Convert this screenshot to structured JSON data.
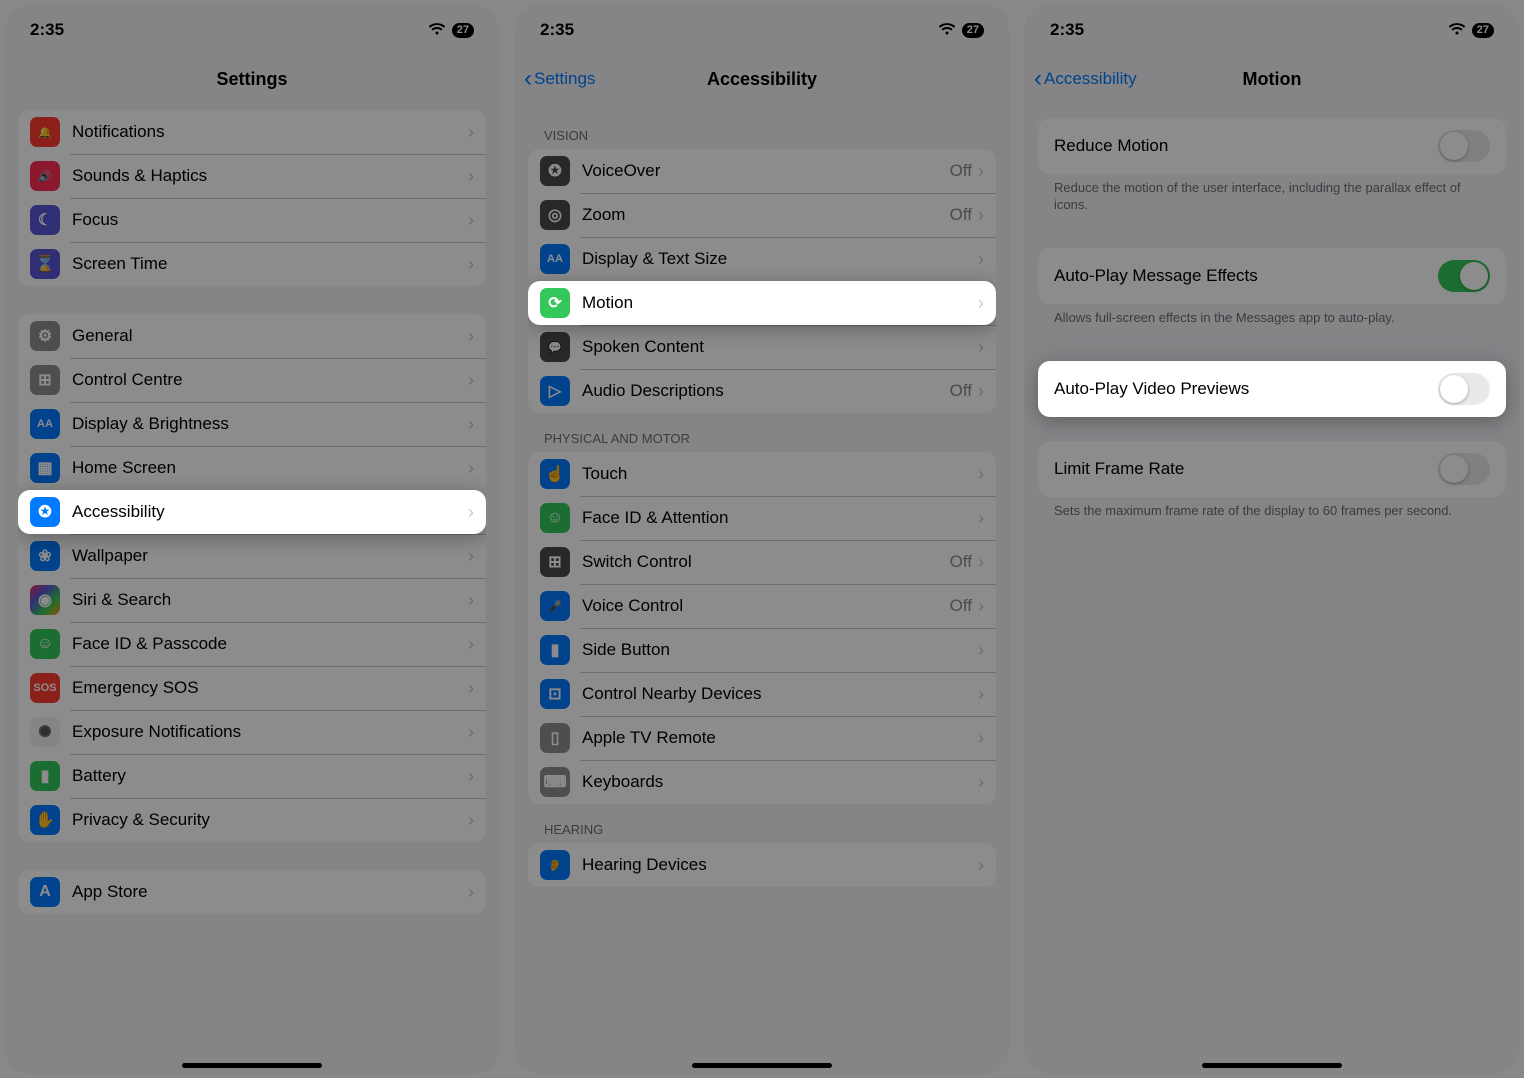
{
  "statusbar": {
    "time": "2:35",
    "battery": "27"
  },
  "screen1": {
    "title": "Settings",
    "group1": [
      {
        "icon": "🔔",
        "color": "ic-red",
        "label": "Notifications"
      },
      {
        "icon": "🔊",
        "color": "ic-pink",
        "label": "Sounds & Haptics"
      },
      {
        "icon": "☾",
        "color": "ic-purple",
        "label": "Focus"
      },
      {
        "icon": "⌛",
        "color": "ic-purple",
        "label": "Screen Time"
      }
    ],
    "group2": [
      {
        "icon": "⚙",
        "color": "ic-gray",
        "label": "General"
      },
      {
        "icon": "⊞",
        "color": "ic-gray",
        "label": "Control Centre"
      },
      {
        "icon": "AA",
        "color": "ic-blue",
        "label": "Display & Brightness"
      },
      {
        "icon": "▦",
        "color": "ic-blue",
        "label": "Home Screen"
      },
      {
        "icon": "✪",
        "color": "ic-blue",
        "label": "Accessibility",
        "highlight": true
      },
      {
        "icon": "❀",
        "color": "ic-blue",
        "label": "Wallpaper"
      },
      {
        "icon": "◉",
        "color": "ic-custom",
        "label": "Siri & Search"
      },
      {
        "icon": "☺",
        "color": "ic-green",
        "label": "Face ID & Passcode"
      },
      {
        "icon": "SOS",
        "color": "ic-red",
        "label": "Emergency SOS"
      },
      {
        "icon": "✺",
        "color": "ic-white",
        "label": "Exposure Notifications"
      },
      {
        "icon": "▮",
        "color": "ic-green",
        "label": "Battery"
      },
      {
        "icon": "✋",
        "color": "ic-blue",
        "label": "Privacy & Security"
      }
    ],
    "group3": [
      {
        "icon": "A",
        "color": "ic-blue",
        "label": "App Store"
      }
    ]
  },
  "screen2": {
    "back": "Settings",
    "title": "Accessibility",
    "vision_header": "VISION",
    "vision": [
      {
        "icon": "✪",
        "color": "ic-darkgray",
        "label": "VoiceOver",
        "value": "Off"
      },
      {
        "icon": "◎",
        "color": "ic-darkgray",
        "label": "Zoom",
        "value": "Off"
      },
      {
        "icon": "AA",
        "color": "ic-blue",
        "label": "Display & Text Size"
      },
      {
        "icon": "⟳",
        "color": "ic-green",
        "label": "Motion",
        "highlight": true
      },
      {
        "icon": "💬",
        "color": "ic-darkgray",
        "label": "Spoken Content"
      },
      {
        "icon": "▷",
        "color": "ic-blue",
        "label": "Audio Descriptions",
        "value": "Off"
      }
    ],
    "physical_header": "PHYSICAL AND MOTOR",
    "physical": [
      {
        "icon": "☝",
        "color": "ic-blue",
        "label": "Touch"
      },
      {
        "icon": "☺",
        "color": "ic-green",
        "label": "Face ID & Attention"
      },
      {
        "icon": "⊞",
        "color": "ic-darkgray",
        "label": "Switch Control",
        "value": "Off"
      },
      {
        "icon": "🎤",
        "color": "ic-blue",
        "label": "Voice Control",
        "value": "Off"
      },
      {
        "icon": "▮",
        "color": "ic-blue",
        "label": "Side Button"
      },
      {
        "icon": "⊡",
        "color": "ic-blue",
        "label": "Control Nearby Devices"
      },
      {
        "icon": "▯",
        "color": "ic-gray",
        "label": "Apple TV Remote"
      },
      {
        "icon": "⌨",
        "color": "ic-gray",
        "label": "Keyboards"
      }
    ],
    "hearing_header": "HEARING",
    "hearing": [
      {
        "icon": "👂",
        "color": "ic-blue",
        "label": "Hearing Devices"
      }
    ]
  },
  "screen3": {
    "back": "Accessibility",
    "title": "Motion",
    "rows": [
      {
        "label": "Reduce Motion",
        "toggle": "off",
        "footer": "Reduce the motion of the user interface, including the parallax effect of icons."
      },
      {
        "label": "Auto-Play Message Effects",
        "toggle": "on",
        "footer": "Allows full-screen effects in the Messages app to auto-play."
      },
      {
        "label": "Auto-Play Video Previews",
        "toggle": "off",
        "highlight": true
      },
      {
        "label": "Limit Frame Rate",
        "toggle": "off",
        "footer": "Sets the maximum frame rate of the display to 60 frames per second."
      }
    ]
  }
}
